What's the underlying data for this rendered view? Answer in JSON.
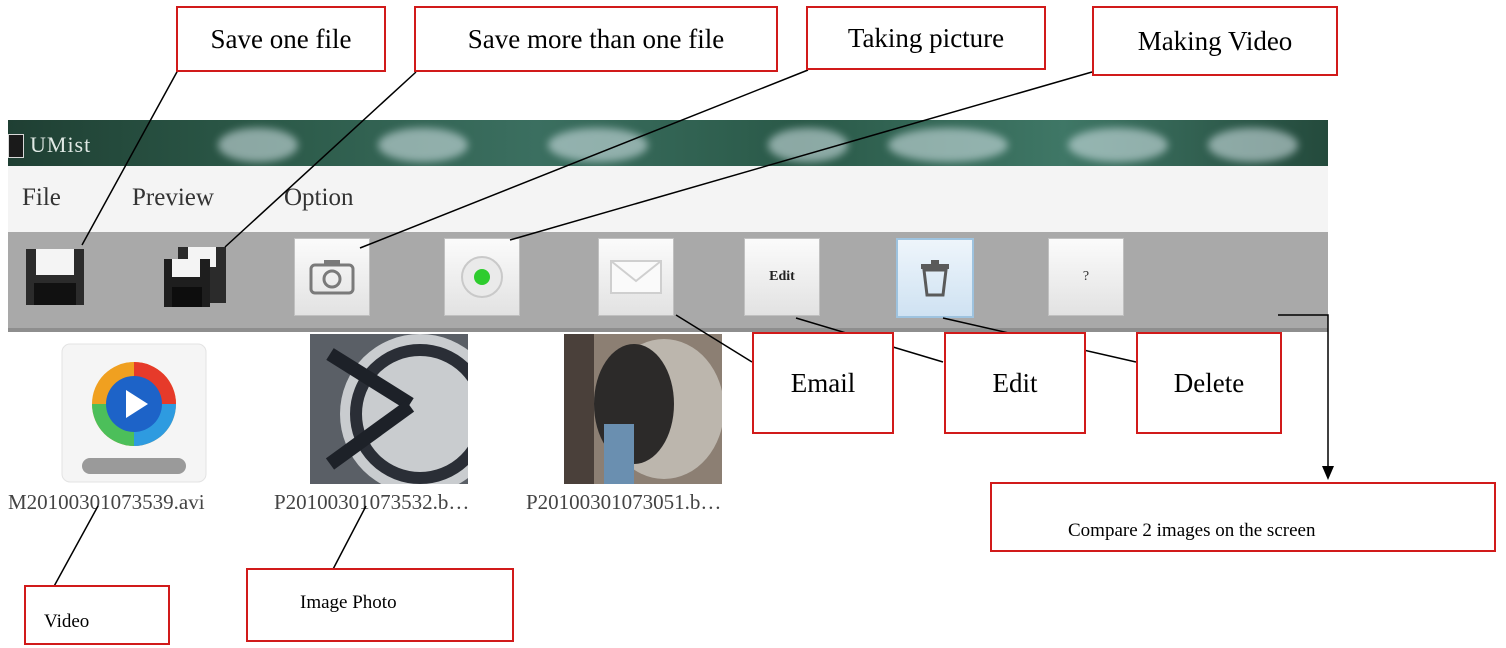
{
  "app": {
    "title": "UMist",
    "menu": [
      "File",
      "Preview",
      "Option"
    ],
    "toolbar": {
      "edit_label": "Edit",
      "help_label": "?"
    },
    "files": [
      {
        "name": "M20100301073539.avi",
        "type": "video"
      },
      {
        "name": "P20100301073532.b…",
        "type": "image"
      },
      {
        "name": "P20100301073051.b…",
        "type": "image"
      }
    ]
  },
  "callouts": {
    "save_one": "Save one file",
    "save_more": "Save more than one file",
    "taking_picture": "Taking picture",
    "making_video": "Making Video",
    "email": "Email",
    "edit": "Edit",
    "delete": "Delete",
    "compare": "Compare 2 images on the screen",
    "video": "Video",
    "image_photo": "Image Photo"
  },
  "colors": {
    "callout_border": "#d11a1a",
    "toolbar_bg": "#a9a9a9",
    "record_dot": "#2ecc2e"
  }
}
